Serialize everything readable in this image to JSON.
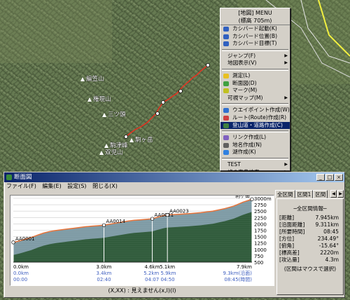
{
  "map": {
    "labels": [
      "編笠山",
      "権現山",
      "三ツ頭",
      "駒ヶ岳",
      "駒津峰",
      "双児山"
    ]
  },
  "context_menu": {
    "header_title": "[地図] MENU",
    "header_elevation": "(標高 705m)",
    "items": [
      {
        "label": "カシバード起動(K)",
        "icon": "bird-icon"
      },
      {
        "label": "カシバード位置(B)",
        "icon": "bird-position-icon"
      },
      {
        "label": "カシバード目標(T)",
        "icon": "bird-target-icon"
      },
      {
        "label": "ジャンプ(F)",
        "submenu": true
      },
      {
        "label": "地図表示(V)",
        "submenu": true
      },
      {
        "label": "測定(L)",
        "icon": "ruler-icon"
      },
      {
        "label": "断面図(D)",
        "icon": "profile-icon"
      },
      {
        "label": "マーク(M)",
        "icon": "mark-icon"
      },
      {
        "label": "可視マップ(M)",
        "submenu": true
      },
      {
        "label": "ウエイポイント作成(W)",
        "icon": "waypoint-icon"
      },
      {
        "label": "ルート(Route)作成(R)",
        "icon": "route-icon"
      },
      {
        "label": "登山道・道路作成(C)",
        "icon": "trail-icon",
        "selected": true
      },
      {
        "label": "リンク作成(L)",
        "icon": "link-icon"
      },
      {
        "label": "地名作成(N)",
        "icon": "flag-icon"
      },
      {
        "label": "湖作成(K)",
        "icon": "lake-icon"
      },
      {
        "label": "TEST",
        "submenu": true
      },
      {
        "label": "旅の事典検索",
        "submenu": true
      }
    ]
  },
  "window": {
    "title": "断面図",
    "menu": [
      "ファイル(F)",
      "編集(E)",
      "設定(S)",
      "閉じる(X)"
    ],
    "status": "(X,XX) : 見えません(x,l)(l)",
    "tabs": [
      "全区間",
      "区間1",
      "区間"
    ]
  },
  "chart_data": {
    "type": "area",
    "ylabel_ticks": [
      "3000m",
      "2750",
      "2500",
      "2250",
      "2000",
      "1750",
      "1500",
      "1250",
      "1000",
      "750",
      "500"
    ],
    "ylim": [
      500,
      3000
    ],
    "x_labels": [
      "0.0km",
      "3.0km",
      "4.6km",
      "5.1km",
      "7.9km"
    ],
    "x_km": [
      0.0,
      3.0,
      4.6,
      5.1,
      7.9
    ],
    "x_sub_labels_1": [
      "0.0km",
      "3.4km",
      "5.2km 5.9km",
      "9.3km(沿面)"
    ],
    "x_sub_labels_2": [
      "00:00",
      "02:40",
      "04:07 04:50",
      "08:45(時間)"
    ],
    "waypoints": [
      {
        "name": "AA0001",
        "km": 0.0,
        "elev": 1275
      },
      {
        "name": "AA0014",
        "km": 3.0,
        "elev": 1950
      },
      {
        "name": "AA0021",
        "km": 4.6,
        "elev": 2200
      },
      {
        "name": "AA0023",
        "km": 5.1,
        "elev": 2350
      },
      {
        "name": "駒ヶ岳",
        "km": 7.9,
        "elev": 2966
      }
    ],
    "profile": [
      [
        0.0,
        1275
      ],
      [
        0.2,
        1330
      ],
      [
        0.4,
        1400
      ],
      [
        0.6,
        1470
      ],
      [
        0.8,
        1560
      ],
      [
        1.0,
        1640
      ],
      [
        1.2,
        1700
      ],
      [
        1.4,
        1740
      ],
      [
        1.6,
        1770
      ],
      [
        1.8,
        1800
      ],
      [
        2.0,
        1830
      ],
      [
        2.2,
        1860
      ],
      [
        2.4,
        1890
      ],
      [
        2.6,
        1910
      ],
      [
        2.8,
        1930
      ],
      [
        3.0,
        1950
      ],
      [
        3.2,
        1990
      ],
      [
        3.4,
        2030
      ],
      [
        3.6,
        2070
      ],
      [
        3.8,
        2110
      ],
      [
        4.0,
        2140
      ],
      [
        4.2,
        2160
      ],
      [
        4.4,
        2180
      ],
      [
        4.6,
        2200
      ],
      [
        4.8,
        2270
      ],
      [
        5.0,
        2330
      ],
      [
        5.1,
        2350
      ],
      [
        5.4,
        2370
      ],
      [
        5.8,
        2400
      ],
      [
        6.2,
        2440
      ],
      [
        6.6,
        2500
      ],
      [
        7.0,
        2600
      ],
      [
        7.3,
        2700
      ],
      [
        7.6,
        2850
      ],
      [
        7.9,
        2966
      ]
    ],
    "colors": {
      "area_top": "#e8743a",
      "area_fill": "#2f5a3a",
      "area_light": "#9ab0c8"
    }
  },
  "summary": {
    "title": "─全区間情報─",
    "rows": [
      {
        "label": "[距離]",
        "value": "7.945km"
      },
      {
        "label": "[沿面距離]",
        "value": "9.311km"
      },
      {
        "label": "[所要時間]",
        "value": "08:45"
      },
      {
        "label": "[方位]",
        "value": "234.49°"
      },
      {
        "label": "[俯角]",
        "value": "-15.64°"
      },
      {
        "label": "[標高差]",
        "value": "2220m"
      },
      {
        "label": "[攻込量]",
        "value": "4.3m"
      }
    ],
    "note": "(区間はマウスで選択)"
  }
}
